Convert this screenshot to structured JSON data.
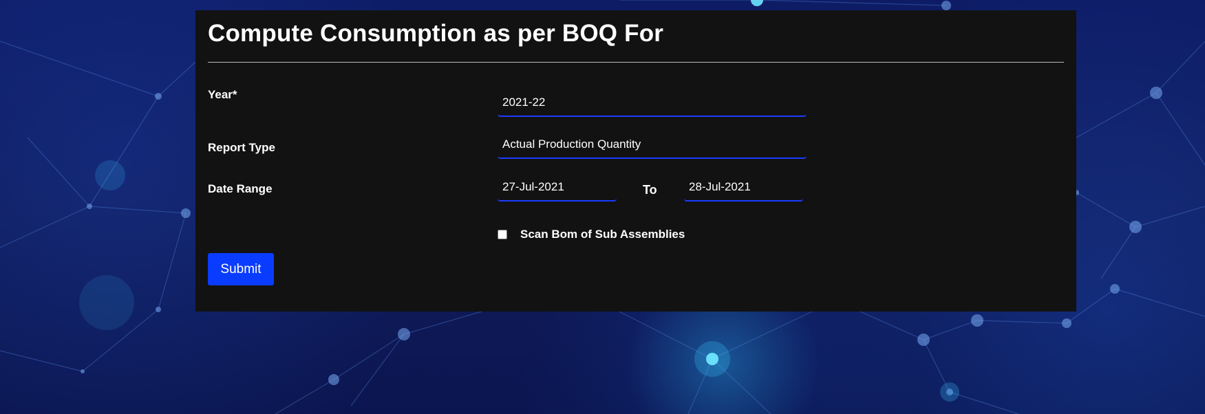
{
  "form": {
    "title": "Compute Consumption as per BOQ For",
    "year": {
      "label": "Year*",
      "value": "2021-22"
    },
    "report_type": {
      "label": "Report Type",
      "value": "Actual Production Quantity"
    },
    "date_range": {
      "label": "Date Range",
      "from": "27-Jul-2021",
      "to_label": "To",
      "to": "28-Jul-2021"
    },
    "scan_bom": {
      "label": "Scan Bom of Sub Assemblies",
      "checked": false
    },
    "submit_label": "Submit"
  },
  "colors": {
    "panel": "#121212",
    "accent": "#0a3cff",
    "field_underline": "#1a3dff",
    "background": "#111c5c"
  }
}
